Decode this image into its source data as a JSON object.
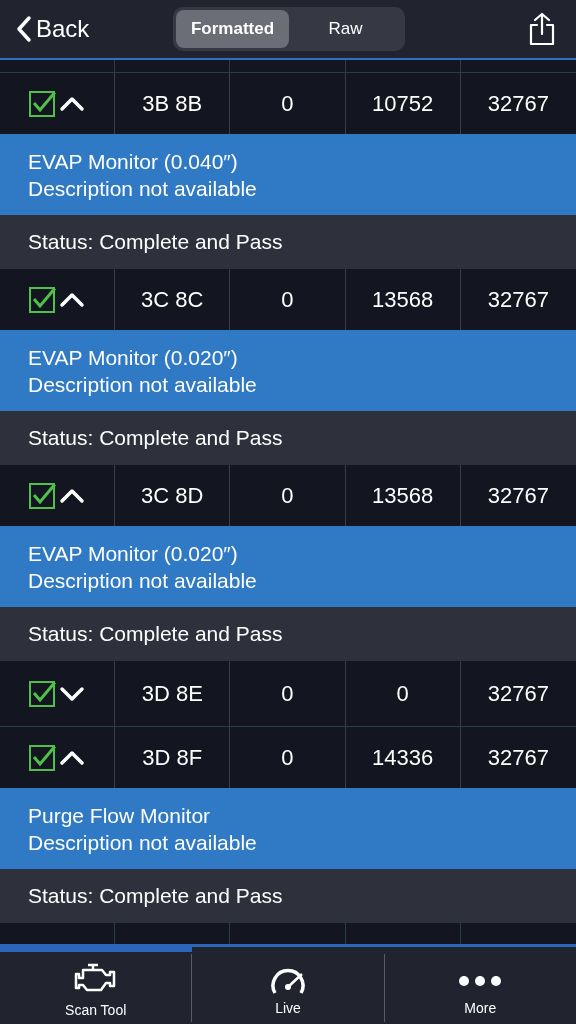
{
  "header": {
    "back": "Back",
    "segments": [
      {
        "label": "Formatted",
        "selected": true
      },
      {
        "label": "Raw",
        "selected": false
      }
    ]
  },
  "rows": [
    {
      "checked": true,
      "expanded": true,
      "cells": [
        "3B 8B",
        "0",
        "10752",
        "32767"
      ],
      "title": "EVAP Monitor (0.040″)",
      "description": "Description not available",
      "status": "Status: Complete and Pass"
    },
    {
      "checked": true,
      "expanded": true,
      "cells": [
        "3C 8C",
        "0",
        "13568",
        "32767"
      ],
      "title": "EVAP Monitor (0.020″)",
      "description": "Description not available",
      "status": "Status: Complete and Pass"
    },
    {
      "checked": true,
      "expanded": true,
      "cells": [
        "3C 8D",
        "0",
        "13568",
        "32767"
      ],
      "title": "EVAP Monitor (0.020″)",
      "description": "Description not available",
      "status": "Status: Complete and Pass"
    },
    {
      "checked": true,
      "expanded": false,
      "cells": [
        "3D 8E",
        "0",
        "0",
        "32767"
      ]
    },
    {
      "checked": true,
      "expanded": true,
      "cells": [
        "3D 8F",
        "0",
        "14336",
        "32767"
      ],
      "title": "Purge Flow Monitor",
      "description": "Description not available",
      "status": "Status: Complete and Pass"
    }
  ],
  "tab_bar": [
    {
      "label": "Scan Tool",
      "kind": "engine",
      "selected": true
    },
    {
      "label": "Live",
      "kind": "gauge",
      "selected": false
    },
    {
      "label": "More",
      "kind": "dots",
      "selected": false
    }
  ]
}
